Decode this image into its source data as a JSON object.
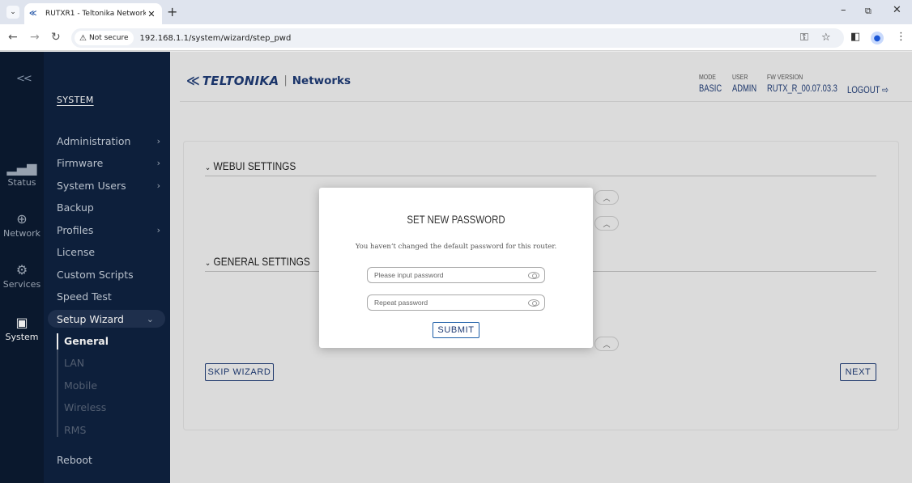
{
  "browser": {
    "tab_title": "RUTXR1 - Teltonika Networks",
    "tab_close": "✕",
    "new_tab": "+",
    "security_label": "Not secure",
    "url": "192.168.1.1/system/wizard/step_pwd",
    "window_controls": {
      "minimize": "–",
      "restore": "⧉",
      "close": "✕"
    },
    "icons": [
      "tab-search-icon",
      "favicon-teltonika-icon",
      "back-icon",
      "forward-icon",
      "reload-icon",
      "warning-icon",
      "password-key-icon",
      "bookmark-star-icon",
      "side-panel-icon",
      "profile-icon",
      "kebab-menu-icon"
    ]
  },
  "rail": {
    "collapse": "<<",
    "items": [
      {
        "label": "Status",
        "icon": "signal-bars-icon"
      },
      {
        "label": "Network",
        "icon": "globe-icon"
      },
      {
        "label": "Services",
        "icon": "gear-icon"
      },
      {
        "label": "System",
        "icon": "device-icon"
      }
    ]
  },
  "menu": {
    "heading": "SYSTEM",
    "items": [
      {
        "label": "Administration",
        "chevron": "›"
      },
      {
        "label": "Firmware",
        "chevron": "›"
      },
      {
        "label": "System Users",
        "chevron": "›"
      },
      {
        "label": "Backup"
      },
      {
        "label": "Profiles",
        "chevron": "›"
      },
      {
        "label": "License"
      },
      {
        "label": "Custom Scripts"
      },
      {
        "label": "Speed Test"
      },
      {
        "label": "Setup Wizard",
        "chevron": "⌄"
      }
    ],
    "sub_items": [
      "General",
      "LAN",
      "Mobile",
      "Wireless",
      "RMS"
    ],
    "reboot": "Reboot"
  },
  "header": {
    "brand": "TELTONIKA",
    "separator": "|",
    "networks": "Networks",
    "mode_label": "MODE",
    "mode_value": "BASIC",
    "user_label": "USER",
    "user_value": "ADMIN",
    "fw_label": "FW VERSION",
    "fw_value": "RUTX_R_00.07.03.3",
    "logout": "LOGOUT",
    "logout_icon": "⇨"
  },
  "content": {
    "section_webui": "WEBUI SETTINGS",
    "section_general": "GENERAL SETTINGS",
    "section_chevron": "⌄",
    "skip_wizard": "SKIP WIZARD",
    "next": "NEXT",
    "stepper_glyph": "︿"
  },
  "modal": {
    "title": "SET NEW PASSWORD",
    "message": "You haven’t changed the default password for this router.",
    "password_placeholder": "Please input password",
    "password_value": "",
    "repeat_placeholder": "Repeat password",
    "repeat_value": "",
    "submit": "SUBMIT"
  },
  "colors": {
    "rail_bg": "#0b1a31",
    "menu_bg": "#0f2240",
    "brand_blue": "#1e3a73",
    "page_bg": "#ececec"
  }
}
